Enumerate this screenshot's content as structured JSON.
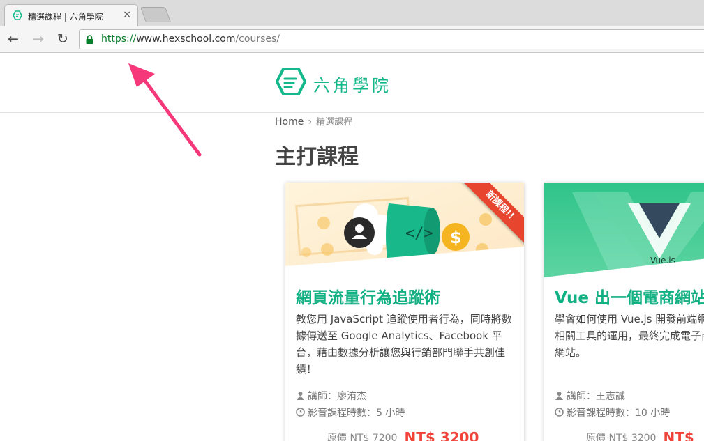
{
  "browser": {
    "tab_title": "精選課程 | 六角學院",
    "tab_close": "×",
    "nav_back": "←",
    "nav_forward": "→",
    "nav_reload": "↻",
    "url_scheme": "https://",
    "url_host": "www.hexschool.com",
    "url_path": "/courses/"
  },
  "site": {
    "logo_text": "六角學院",
    "brand_color": "#14b88a"
  },
  "breadcrumb": {
    "home": "Home",
    "separator": "›",
    "current": "精選課程"
  },
  "page_title": "主打課程",
  "courses": [
    {
      "ribbon": "新課程!!",
      "title": "網頁流量行為追蹤術",
      "description": "教您用 JavaScript 追蹤使用者行為，同時將數據傳送至 Google Analytics、Facebook 平台，藉由數據分析讓您與行銷部門聯手共創佳績！",
      "teacher": "講師：廖洧杰",
      "hours": "影音課程時數：5 小時",
      "original_price": "原價 NT$ 7200",
      "sale_price": "NT$ 3200"
    },
    {
      "cover_label": "Vue.js",
      "title": "Vue 出一個電商網站",
      "description": "學會如何使用 Vue.js 開發前端網站，相關工具的運用，最終完成電子商務網站。",
      "teacher": "講師：王志誠",
      "hours": "影音課程時數：10 小時",
      "original_price": "原價 NT$ 3200",
      "sale_price": "NT$"
    }
  ],
  "colors": {
    "accent_green": "#14b88a",
    "sale_red": "#f0433a",
    "ribbon_red": "#e8452f",
    "annotation_pink": "#f4387a"
  }
}
